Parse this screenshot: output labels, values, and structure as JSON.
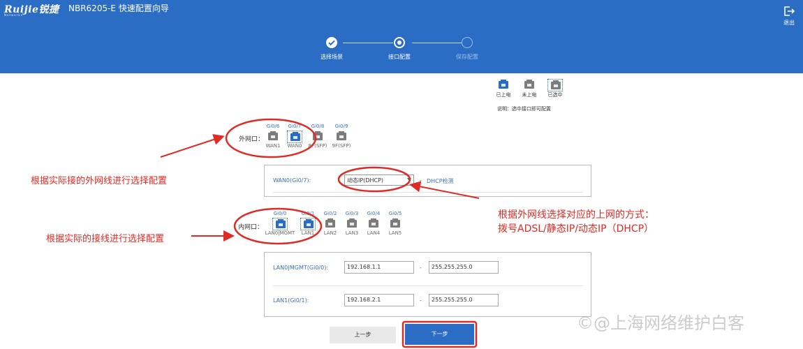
{
  "header": {
    "logo": "Ruijie锐捷",
    "logo_sub": "Networks",
    "title": "NBR6205-E  快速配置向导",
    "logout_label": "退出"
  },
  "steps": [
    {
      "label": "选择场景",
      "state": "done"
    },
    {
      "label": "接口配置",
      "state": "current"
    },
    {
      "label": "保存配置",
      "state": "todo"
    }
  ],
  "legend": {
    "items": [
      "已上电",
      "未上电",
      "已选中"
    ],
    "note": "说明：选中接口即可配置"
  },
  "wan": {
    "row_label": "外网口：",
    "ports": [
      {
        "name": "Gi0/6",
        "label": "WAN1",
        "state": "off"
      },
      {
        "name": "Gi0/7",
        "label": "WAN0",
        "state": "selected"
      },
      {
        "name": "Gi0/8",
        "label": "8F(SFP)",
        "state": "off"
      },
      {
        "name": "Gi0/9",
        "label": "9F(SFP)",
        "state": "off"
      }
    ],
    "config": {
      "field_label": "WAN0(Gi0/7):",
      "select_value": "动态IP(DHCP)",
      "separator": "-",
      "link": "DHCP检测"
    }
  },
  "lan": {
    "row_label": "内网口：",
    "ports": [
      {
        "name": "Gi0/0",
        "label": "LAN0|MGMT",
        "state": "on-selected"
      },
      {
        "name": "Gi0/1",
        "label": "LAN1",
        "state": "on-selected"
      },
      {
        "name": "Gi0/2",
        "label": "LAN2",
        "state": "off"
      },
      {
        "name": "Gi0/3",
        "label": "LAN3",
        "state": "off"
      },
      {
        "name": "Gi0/4",
        "label": "LAN4",
        "state": "off"
      },
      {
        "name": "Gi0/5",
        "label": "LAN5",
        "state": "off"
      }
    ],
    "config": [
      {
        "label": "LAN0|MGMT(Gi0/0):",
        "ip": "192.168.1.1",
        "mask": "255.255.255.0"
      },
      {
        "label": "LAN1(Gi0/1):",
        "ip": "192.168.2.1",
        "mask": "255.255.255.0"
      }
    ],
    "separator": "-"
  },
  "buttons": {
    "prev": "上一步",
    "next": "下一步"
  },
  "annotations": {
    "wan_hint": "根据实际接的外网线进行选择配置",
    "mode_hint_line1": "根据外网线选择对应的上网的方式：",
    "mode_hint_line2": "拨号ADSL/静态IP/动态IP（DHCP）",
    "lan_hint": "根据实际的接线进行选择配置"
  },
  "watermark": "©@上海网络维护白客",
  "colors": {
    "brand": "#2b6cc4",
    "annotation": "#e02b24"
  }
}
